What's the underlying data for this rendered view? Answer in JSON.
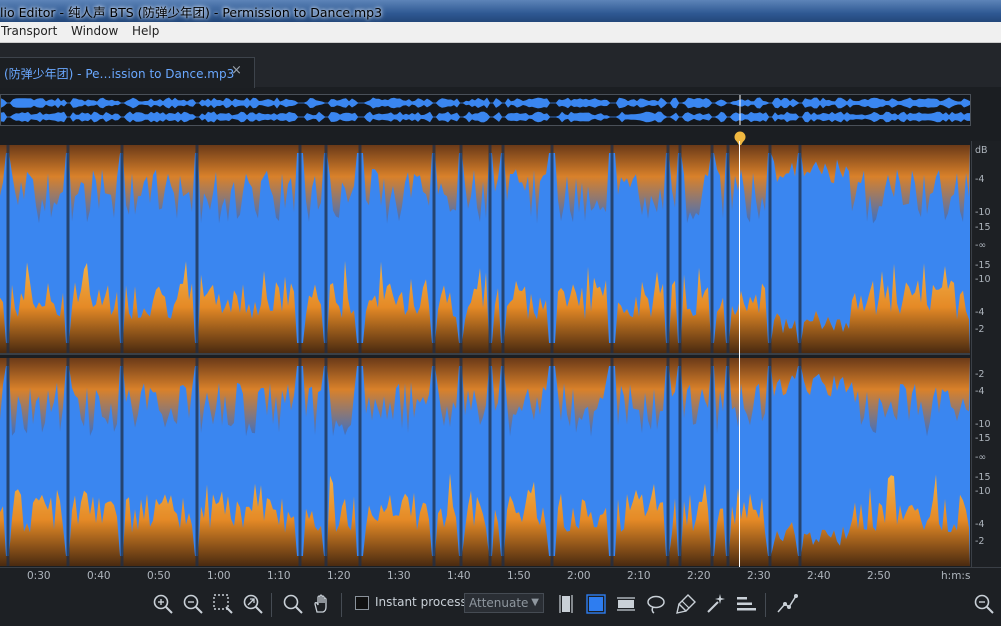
{
  "window": {
    "title": "lio Editor - 纯人声 BTS (防弹少年团) - Permission to Dance.mp3"
  },
  "menu": {
    "items": [
      "Transport",
      "Window",
      "Help"
    ]
  },
  "tab": {
    "label": "(防弹少年团) - Pe…ission to Dance.mp3",
    "close": "×"
  },
  "db_scale": {
    "top_channel": [
      "dB",
      "-4",
      "-10",
      "-15",
      "-∞",
      "-15",
      "-10",
      "-4",
      "-2"
    ],
    "bottom_channel": [
      "-2",
      "-4",
      "-10",
      "-15",
      "-∞",
      "-15",
      "-10",
      "-4",
      "-2"
    ]
  },
  "timeline": {
    "labels": [
      "0:30",
      "0:40",
      "0:50",
      "1:00",
      "1:10",
      "1:20",
      "1:30",
      "1:40",
      "1:50",
      "2:00",
      "2:10",
      "2:20",
      "2:30",
      "2:40",
      "2:50"
    ],
    "unit": "h:m:s"
  },
  "playhead": {
    "time": "2:27"
  },
  "toolbar": {
    "instant_process_label": "Instant process",
    "mode_value": "Attenuate",
    "instant_process_checked": false
  },
  "colors": {
    "waveform": "#3a86f0",
    "spectrum": "#e8882a",
    "accent": "#2e7df0",
    "playhead": "#f0b840"
  }
}
